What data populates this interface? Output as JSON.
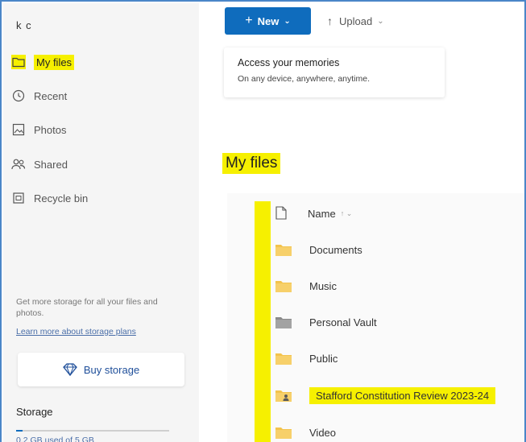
{
  "sidebar": {
    "user": "k c",
    "nav": [
      {
        "label": "My files",
        "icon": "folder-icon",
        "active": true
      },
      {
        "label": "Recent",
        "icon": "clock-icon",
        "active": false
      },
      {
        "label": "Photos",
        "icon": "photo-icon",
        "active": false
      },
      {
        "label": "Shared",
        "icon": "people-icon",
        "active": false
      },
      {
        "label": "Recycle bin",
        "icon": "trash-icon",
        "active": false
      }
    ],
    "promo_text": "Get more storage for all your files and photos.",
    "promo_link": "Learn more about storage plans",
    "buy_label": "Buy storage",
    "storage_title": "Storage",
    "storage_used": "0.2 GB used of 5 GB",
    "storage_fraction": 0.04
  },
  "toolbar": {
    "new_label": "New",
    "upload_label": "Upload"
  },
  "memories": {
    "title": "Access your memories",
    "subtitle": "On any device, anywhere, anytime."
  },
  "main": {
    "title": "My files",
    "column_name": "Name",
    "sort_indicator": "↑ ⌄",
    "rows": [
      {
        "label": "Documents",
        "icon": "folder-icon",
        "highlight": false
      },
      {
        "label": "Music",
        "icon": "folder-icon",
        "highlight": false
      },
      {
        "label": "Personal Vault",
        "icon": "vault-icon",
        "highlight": false
      },
      {
        "label": "Public",
        "icon": "folder-icon",
        "highlight": false
      },
      {
        "label": "Stafford Constitution Review 2023-24",
        "icon": "shared-folder-icon",
        "highlight": true
      },
      {
        "label": "Video",
        "icon": "folder-icon",
        "highlight": false
      }
    ]
  },
  "colors": {
    "accent": "#0f6cbd",
    "highlight": "#f6f000",
    "folder": "#f3c34d"
  }
}
